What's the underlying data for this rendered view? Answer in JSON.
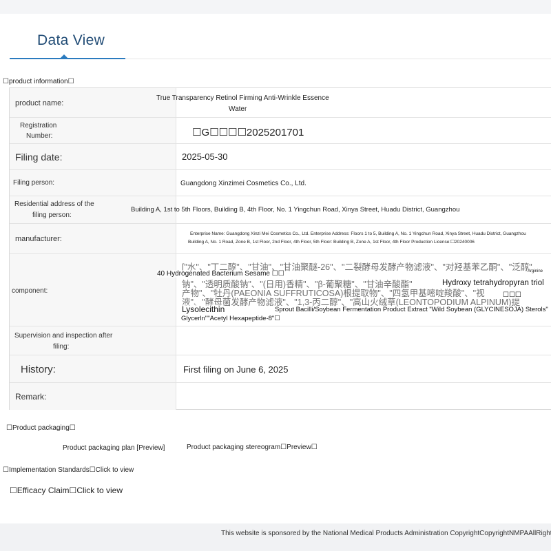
{
  "header": {
    "tab_title": "Data View"
  },
  "sections": {
    "product_info": "☐product information☐",
    "packaging": "☐Product packaging☐",
    "standards": "☐Implementation Standards☐Click to view",
    "efficacy": "☐Efficacy Claim☐Click to view"
  },
  "product": {
    "name_label": "product name:",
    "name_value_line1": "True Transparency Retinol Firming Anti-Wrinkle Essence",
    "name_value_line2": "Water",
    "reg_label_line1": "Registration",
    "reg_label_line2": "Number:",
    "reg_value": "☐G☐☐☐☐2025201701",
    "filing_date_label": "Filing date:",
    "filing_date_value": "2025-05-30",
    "filing_person_label": "Filing person:",
    "filing_person_value": "Guangdong Xinzimei Cosmetics Co., Ltd.",
    "address_label_line1": "Residential address of the",
    "address_label_line2": "filing person:",
    "address_value": "Building A, 1st to 5th Floors, Building B, 4th Floor, No. 1 Yingchun Road, Xinya Street, Huadu District, Guangzhou",
    "manufacturer_label": "manufacturer:",
    "manufacturer_value_line1": "Enterprise Name: Guangdong Xinzi Mei Cosmetics Co., Ltd. Enterprise Address: Floors 1 to 5, Building A, No. 1 Yingchun Road, Xinya Street, Huadu District, Guangzhou",
    "manufacturer_value_line2": "Building A, No. 1 Road, Zone B, 1st Floor, 2nd Floor, 4th Floor, 5th Floor: Building B, Zone A, 1st Floor, 4th Floor Production License:☐20240006",
    "component_label": "component:",
    "component_cn_1": "[\"水\"、\"丁二醇\"、\"甘油\"、\"甘油聚醚-26\"、\"二裂酵母发酵产物滤液\"、\"对羟基苯乙酮\"、\"泛醇\"",
    "component_cn_2": "钠\"、\"透明质酸钠\"、\"(日用)香精\"、\"β-葡聚糖\"、\"甘油辛酸酯\"",
    "component_cn_3": "产物\"、\"牡丹(PAEONIA SUFFRUTICOSA)根提取物\"、\"四氢甲基嘧啶羧酸\"、\"视",
    "component_cn_4": "液\"、\"酵母菌发酵产物滤液\"、\"1,3-丙二醇\"、\"高山火绒草(LEONTOPODIUM ALPINUM)提",
    "component_en_1": "40 Hydrogenated Bacterium Sesame ☐☐",
    "component_en_2": "Hydroxy tetrahydropyran triol",
    "component_en_3": "Arginine",
    "component_en_4": "☐☐☐",
    "component_en_5": "Lysolecithin",
    "component_en_6": "Sprout Bacilli/Soybean Fermentation Product Extract \"Wild Soybean (GLYCINESOJA) Sterols\"",
    "component_en_7": "Glycerln\"\"Acetyl Hexapeptide-8\"☐",
    "supervision_label_line1": "Supervision and inspection after",
    "supervision_label_line2": "filing:",
    "supervision_value": "",
    "history_label": "History:",
    "history_value": "First filing on June 6, 2025",
    "remark_label": "Remark:",
    "remark_value": ""
  },
  "packaging": {
    "plan_link": "Product packaging plan [Preview]",
    "stereogram_link": "Product packaging stereogram☐Preview☐"
  },
  "footer": {
    "text": "This website is sponsored by the National Medical Products Administration CopyrightCopyrightNMPAAllRightsRes"
  }
}
